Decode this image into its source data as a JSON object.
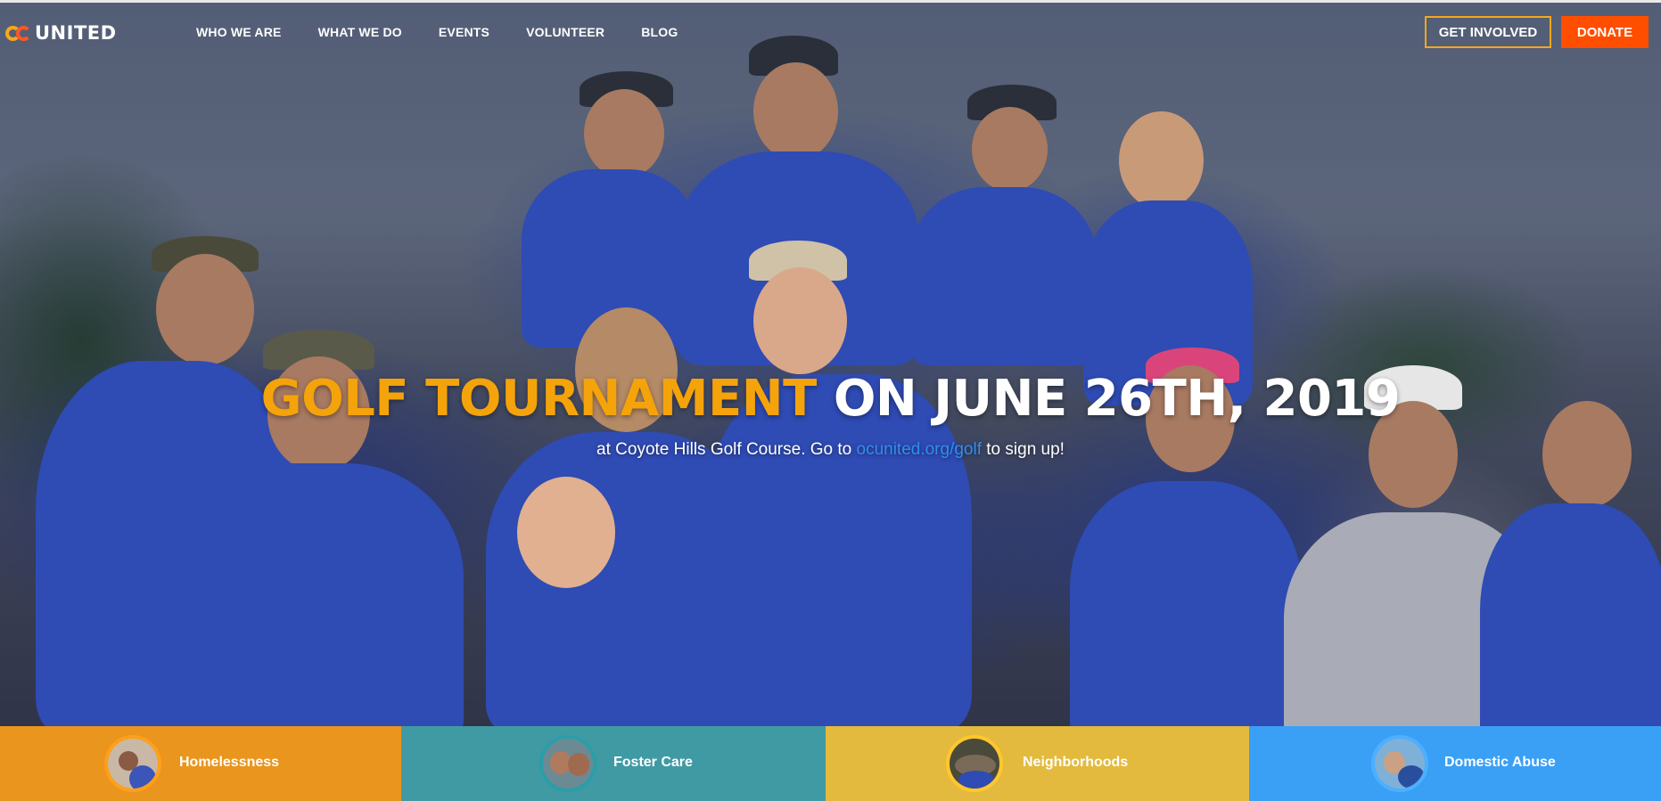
{
  "nav": {
    "logo_text": "UNITED",
    "links": [
      {
        "label": "WHO WE ARE"
      },
      {
        "label": "WHAT WE DO"
      },
      {
        "label": "EVENTS"
      },
      {
        "label": "VOLUNTEER"
      },
      {
        "label": "BLOG"
      }
    ],
    "get_involved_label": "GET INVOLVED",
    "donate_label": "DONATE"
  },
  "hero": {
    "headline_accent": "GOLF TOURNAMENT",
    "headline_rest": "ON JUNE 26TH, 2019",
    "subline_before": "at Coyote Hills Golf Course. Go to ",
    "subline_link": "ocunited.org/golf",
    "subline_after": " to sign up!"
  },
  "categories": [
    {
      "label": "Homelessness"
    },
    {
      "label": "Foster Care"
    },
    {
      "label": "Neighborhoods"
    },
    {
      "label": "Domestic Abuse"
    }
  ],
  "colors": {
    "accent_orange": "#f5a30a",
    "donate_orange": "#ff4e00",
    "link_blue": "#2f8ef2",
    "homelessness": "#e88c0a",
    "foster_care": "#268c96",
    "neighborhoods": "#e0b228",
    "domestic_abuse": "#3aa0f5"
  },
  "icons": {
    "logo": "oc-logo-icon"
  }
}
